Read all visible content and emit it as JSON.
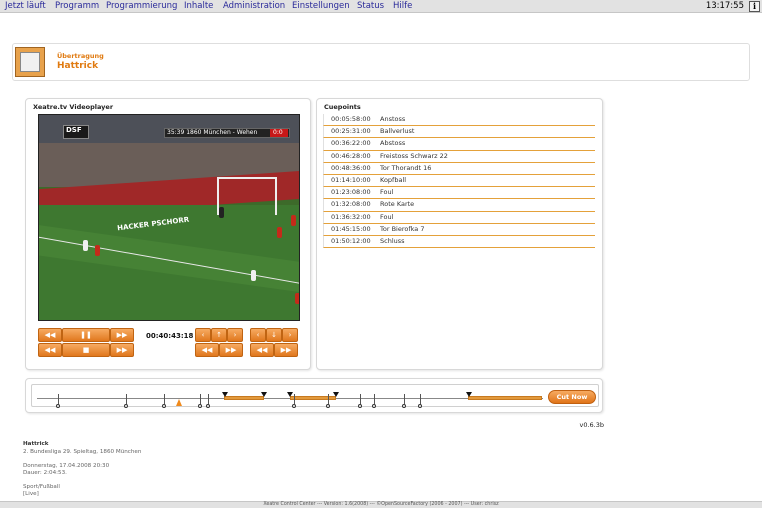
{
  "menu": {
    "items": [
      "Jetzt läuft",
      "Programm",
      "Programmierung",
      "Inhalte",
      "Administration",
      "Einstellungen",
      "Status",
      "Hilfe"
    ],
    "clock": "13:17:55",
    "info_glyph": "i"
  },
  "header": {
    "subtitle": "Übertragung",
    "title": "Hattrick"
  },
  "player": {
    "title": "Xeatre.tv Videoplayer",
    "timecode": "00:40:43:18",
    "channel_logo": "DSF",
    "scoreline": "35:39 1860 München - Wehen",
    "score": "0:0",
    "board_text": "HACKER PSCHORR"
  },
  "cuepoints": {
    "title": "Cuepoints",
    "rows": [
      {
        "time": "00:05:58:00",
        "label": "Anstoss"
      },
      {
        "time": "00:25:31:00",
        "label": "Ballverlust"
      },
      {
        "time": "00:36:22:00",
        "label": "Abstoss"
      },
      {
        "time": "00:46:28:00",
        "label": "Freistoss Schwarz 22"
      },
      {
        "time": "00:48:36:00",
        "label": "Tor Thorandt 16"
      },
      {
        "time": "01:14:10:00",
        "label": "Kopfball"
      },
      {
        "time": "01:23:08:00",
        "label": "Foul"
      },
      {
        "time": "01:32:08:00",
        "label": "Rote Karte"
      },
      {
        "time": "01:36:32:00",
        "label": "Foul"
      },
      {
        "time": "01:45:15:00",
        "label": "Tor Bierofka 7"
      },
      {
        "time": "01:50:12:00",
        "label": "Schluss"
      }
    ]
  },
  "timeline": {
    "cut_label": "Cut Now"
  },
  "version": "v0.6.3b",
  "info": {
    "title": "Hattrick",
    "line1": "2. Bundesliga 29. Spieltag, 1860 München",
    "line2": "Donnerstag, 17.04.2008 20:30",
    "line3": "Dauer: 2:04:53.",
    "line4": "Sport/Fußball",
    "line5": "[Live]"
  },
  "footer": "Xeatre Control Center --- Version: 1.6(2008) --- ©OpenSourceFactory (2006 - 2007) --- User: chrisz",
  "colors": {
    "accent": "#e07a10",
    "menu_text": "#2a2a9a"
  }
}
